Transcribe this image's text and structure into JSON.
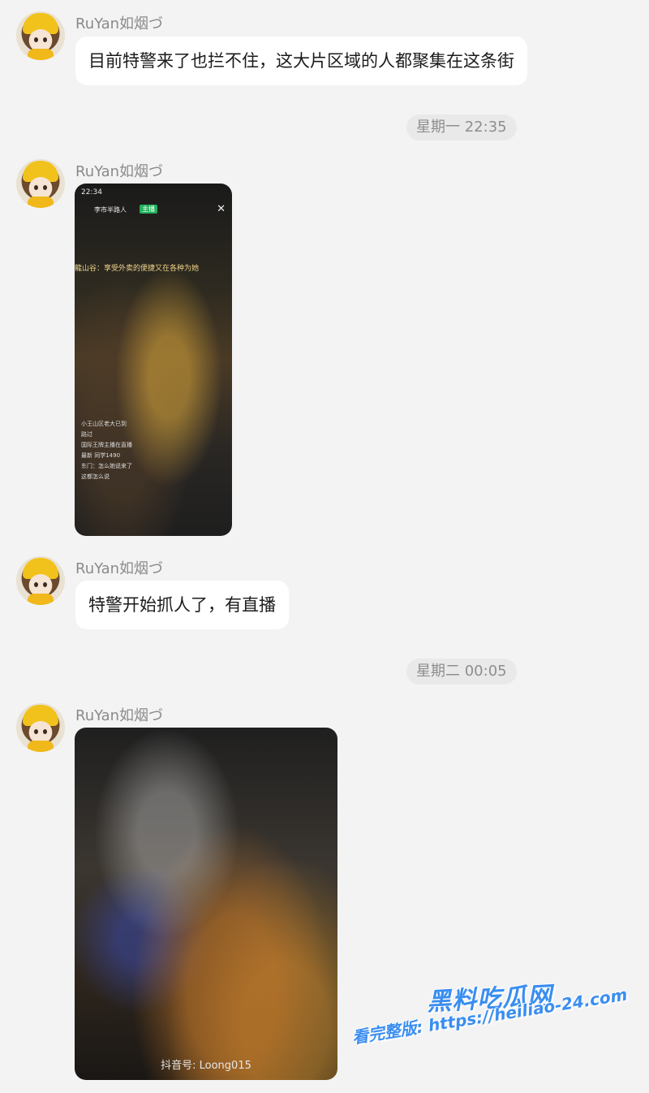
{
  "messages": [
    {
      "username": "RuYan如烟づ",
      "text": "目前特警来了也拦不住，这大片区域的人都聚集在这条街"
    },
    {
      "username": "RuYan如烟づ"
    },
    {
      "username": "RuYan如烟づ",
      "text": "特警开始抓人了，有直播"
    },
    {
      "username": "RuYan如烟づ"
    }
  ],
  "timestamps": [
    "星期一 22:35",
    "星期二 00:05"
  ],
  "media1": {
    "status_time": "22:34",
    "streamer": "李市半路人",
    "badge": "主播",
    "banner": "龍山谷：享受外卖的便捷又在各种为她",
    "comments": [
      "小王山区老大已到",
      "路过",
      "国际王牌主播在直播",
      "最新 同学1490",
      "东门：怎么她说来了",
      "这都怎么说"
    ]
  },
  "media2": {
    "caption": "抖音号: Loong015"
  },
  "watermark": {
    "logo": "黑料吃瓜网",
    "text": "看完整版: https://heiliao-24.com"
  }
}
